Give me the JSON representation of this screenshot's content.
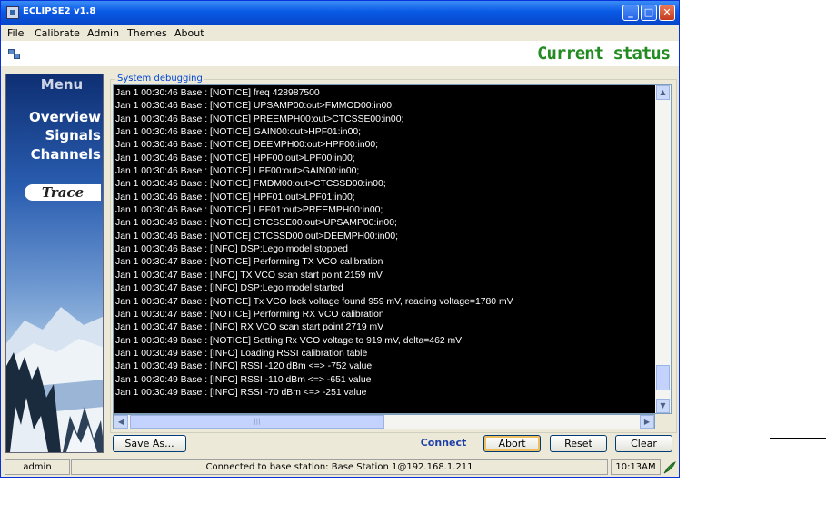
{
  "window": {
    "title": "ECLIPSE2 v1.8"
  },
  "menubar": [
    "File",
    "Calibrate",
    "Admin",
    "Themes",
    "About"
  ],
  "toolbar": {
    "status_title": "Current status"
  },
  "sidebar": {
    "menu_title": "Menu",
    "items": [
      "Overview",
      "Signals",
      "Channels"
    ],
    "trace_label": "Trace"
  },
  "debug": {
    "group_label": "System debugging",
    "lines": [
      "Jan  1 00:30:46 Base : [NOTICE] freq 428987500",
      "Jan  1 00:30:46 Base : [NOTICE] UPSAMP00:out>FMMOD00:in00;",
      "Jan  1 00:30:46 Base : [NOTICE] PREEMPH00:out>CTCSSE00:in00;",
      "Jan  1 00:30:46 Base : [NOTICE] GAIN00:out>HPF01:in00;",
      "Jan  1 00:30:46 Base : [NOTICE] DEEMPH00:out>HPF00:in00;",
      "Jan  1 00:30:46 Base : [NOTICE] HPF00:out>LPF00:in00;",
      "Jan  1 00:30:46 Base : [NOTICE] LPF00:out>GAIN00:in00;",
      "Jan  1 00:30:46 Base : [NOTICE] FMDM00:out>CTCSSD00:in00;",
      "Jan  1 00:30:46 Base : [NOTICE] HPF01:out>LPF01:in00;",
      "Jan  1 00:30:46 Base : [NOTICE] LPF01:out>PREEMPH00:in00;",
      "Jan  1 00:30:46 Base : [NOTICE] CTCSSE00:out>UPSAMP00:in00;",
      "Jan  1 00:30:46 Base : [NOTICE] CTCSSD00:out>DEEMPH00:in00;",
      "Jan  1 00:30:46 Base : [INFO]  DSP:Lego model stopped",
      "Jan  1 00:30:47 Base : [NOTICE] Performing TX VCO calibration",
      "Jan  1 00:30:47 Base : [INFO] TX VCO scan start point 2159 mV",
      "Jan  1 00:30:47 Base : [INFO]  DSP:Lego model started",
      "Jan  1 00:30:47 Base : [NOTICE] Tx VCO lock voltage found 959 mV, reading voltage=1780 mV",
      "Jan  1 00:30:47 Base : [NOTICE] Performing RX VCO calibration",
      "Jan  1 00:30:47 Base : [INFO] RX VCO scan start point 2719 mV",
      "Jan  1 00:30:49 Base : [NOTICE] Setting Rx VCO voltage to 919 mV, delta=462 mV",
      "Jan  1 00:30:49 Base : [INFO] Loading RSSI calibration table",
      "Jan  1 00:30:49 Base : [INFO] RSSI -120 dBm <=> -752 value",
      "Jan  1 00:30:49 Base : [INFO] RSSI -110 dBm <=> -651 value",
      "Jan  1 00:30:49 Base : [INFO] RSSI -70 dBm <=> -251 value"
    ]
  },
  "buttons": {
    "save_as": "Save As...",
    "connect": "Connect",
    "abort": "Abort",
    "reset": "Reset",
    "clear": "Clear"
  },
  "statusbar": {
    "user": "admin",
    "connection": "Connected to base station: Base Station 1@192.168.1.211",
    "time": "10:13AM"
  },
  "icons": [
    "app-icon",
    "minimize-icon",
    "maximize-icon",
    "close-icon",
    "toolbar-icon",
    "scroll-up-icon",
    "scroll-down-icon",
    "scroll-left-icon",
    "scroll-right-icon",
    "network-status-icon"
  ]
}
